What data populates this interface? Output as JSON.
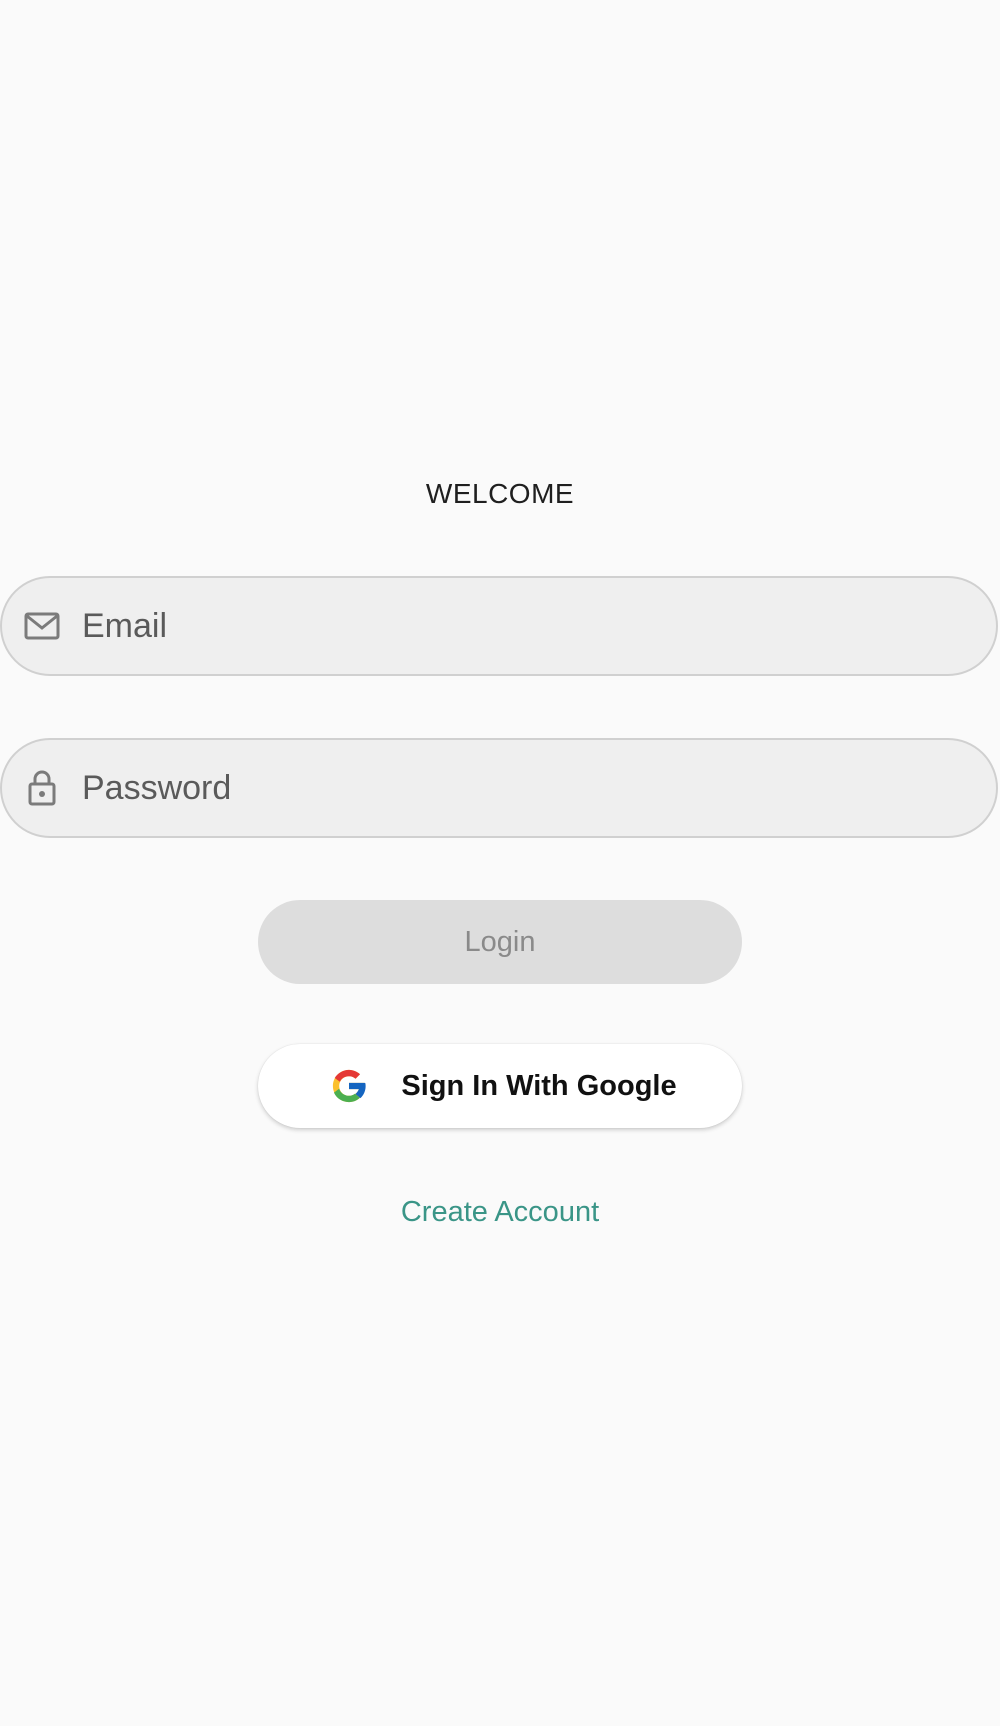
{
  "title": "WELCOME",
  "email": {
    "placeholder": "Email",
    "icon": "mail-icon"
  },
  "password": {
    "placeholder": "Password",
    "icon": "lock-icon"
  },
  "login": {
    "label": "Login"
  },
  "google": {
    "label": "Sign In With Google",
    "icon": "google-logo-icon"
  },
  "create_account": {
    "label": "Create Account"
  },
  "colors": {
    "background": "#fafafa",
    "field_bg": "#efefef",
    "link": "#3a9587",
    "disabled_button": "#dddddd"
  }
}
